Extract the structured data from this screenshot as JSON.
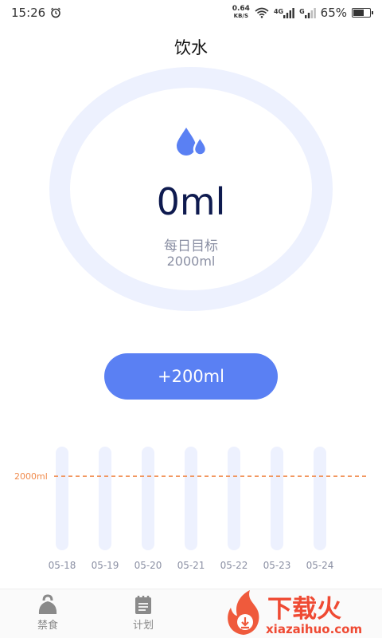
{
  "status_bar": {
    "time": "15:26",
    "net_speed": "0.64",
    "net_unit": "KB/S",
    "signal_tag_1": "4G",
    "signal_tag_2": "G",
    "battery_percent": "65%",
    "battery_level": 0.65
  },
  "header": {
    "title": "饮水"
  },
  "progress": {
    "amount": "0ml",
    "goal_label": "每日目标",
    "goal_value": "2000ml",
    "fraction": 0
  },
  "add_button": {
    "label": "+200ml"
  },
  "chart_data": {
    "type": "bar",
    "categories": [
      "05-18",
      "05-19",
      "05-20",
      "05-21",
      "05-22",
      "05-23",
      "05-24"
    ],
    "values": [
      0,
      0,
      0,
      0,
      0,
      0,
      0
    ],
    "target_line": {
      "label": "2000ml",
      "value": 2000
    },
    "ylim": [
      0,
      2800
    ],
    "grid": false
  },
  "bottom_nav": {
    "items": [
      {
        "label": "禁食",
        "icon": "kettlebell-icon"
      },
      {
        "label": "计划",
        "icon": "notebook-icon"
      }
    ]
  },
  "watermark": {
    "text": "下载火",
    "url_text": "xiazaihuo.com"
  },
  "colors": {
    "accent": "#5a80f3",
    "ring": "#edf1fe",
    "bar_track": "#edf1fe",
    "target_line": "#f08a4b"
  }
}
